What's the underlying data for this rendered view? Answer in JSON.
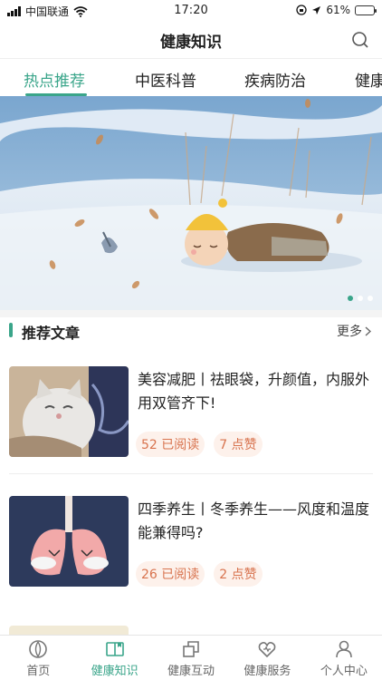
{
  "status_bar": {
    "carrier": "中国联通",
    "time": "17:20",
    "battery": "61%",
    "battery_level": 0.61
  },
  "header": {
    "title": "健康知识",
    "search_icon": "search-icon"
  },
  "tabs": [
    {
      "label": "热点推荐",
      "active": true
    },
    {
      "label": "中医科普",
      "active": false
    },
    {
      "label": "疾病防治",
      "active": false
    },
    {
      "label": "健康",
      "active": false
    }
  ],
  "banner": {
    "slides": 3,
    "active_slide": 1
  },
  "section": {
    "title": "推荐文章",
    "more_label": "更多"
  },
  "articles": [
    {
      "title": "美容减肥丨祛眼袋，升颜值，内服外用双管齐下!",
      "reads": "52 已阅读",
      "likes": "7 点赞"
    },
    {
      "title": "四季养生丨冬季养生——风度和温度能兼得吗?",
      "reads": "26 已阅读",
      "likes": "2 点赞"
    }
  ],
  "bottom_nav": [
    {
      "label": "首页",
      "icon": "home-icon",
      "active": false
    },
    {
      "label": "健康知识",
      "icon": "book-icon",
      "active": true
    },
    {
      "label": "健康互动",
      "icon": "interact-icon",
      "active": false
    },
    {
      "label": "健康服务",
      "icon": "service-icon",
      "active": false
    },
    {
      "label": "个人中心",
      "icon": "user-icon",
      "active": false
    }
  ],
  "colors": {
    "accent": "#3aa58a",
    "tag_text": "#d8734e",
    "tag_bg": "#fdf1eb"
  }
}
